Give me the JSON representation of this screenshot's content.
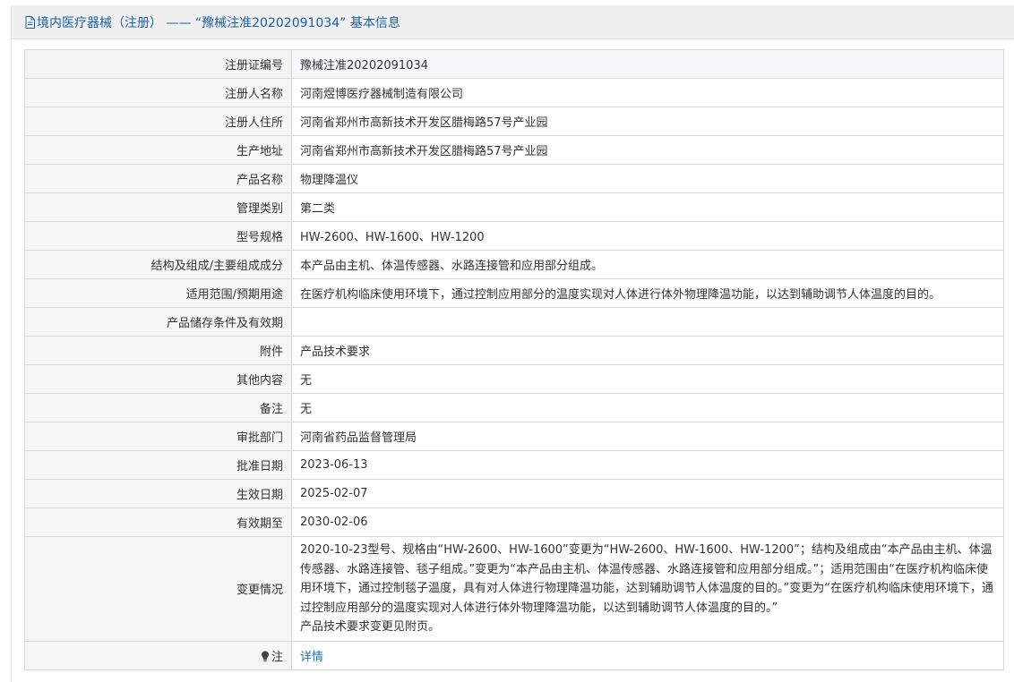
{
  "header": {
    "title": "境内医疗器械（注册） —— “豫械注准20202091034” 基本信息"
  },
  "rows": [
    {
      "label": "注册证编号",
      "value": "豫械注准20202091034"
    },
    {
      "label": "注册人名称",
      "value": "河南煜博医疗器械制造有限公司"
    },
    {
      "label": "注册人住所",
      "value": "河南省郑州市高新技术开发区腊梅路57号产业园"
    },
    {
      "label": "生产地址",
      "value": "河南省郑州市高新技术开发区腊梅路57号产业园"
    },
    {
      "label": "产品名称",
      "value": "物理降温仪"
    },
    {
      "label": "管理类别",
      "value": "第二类"
    },
    {
      "label": "型号规格",
      "value": "HW-2600、HW-1600、HW-1200"
    },
    {
      "label": "结构及组成/主要组成成分",
      "value": "本产品由主机、体温传感器、水路连接管和应用部分组成。"
    },
    {
      "label": "适用范围/预期用途",
      "value": "在医疗机构临床使用环境下，通过控制应用部分的温度实现对人体进行体外物理降温功能，以达到辅助调节人体温度的目的。"
    },
    {
      "label": "产品储存条件及有效期",
      "value": ""
    },
    {
      "label": "附件",
      "value": "产品技术要求"
    },
    {
      "label": "其他内容",
      "value": "无"
    },
    {
      "label": "备注",
      "value": "无"
    },
    {
      "label": "审批部门",
      "value": "河南省药品监督管理局"
    },
    {
      "label": "批准日期",
      "value": "2023-06-13"
    },
    {
      "label": "生效日期",
      "value": "2025-02-07"
    },
    {
      "label": "有效期至",
      "value": "2030-02-06"
    }
  ],
  "change": {
    "label": "变更情况",
    "text": "2020-10-23型号、规格由“HW-2600、HW-1600”变更为“HW-2600、HW-1600、HW-1200”；结构及组成由“本产品由主机、体温传感器、水路连接管、毯子组成。”变更为“本产品由主机、体温传感器、水路连接管和应用部分组成。”；适用范围由“在医疗机构临床使用环境下，通过控制毯子温度，具有对人体进行物理降温功能，达到辅助调节人体温度的目的。”变更为“在医疗机构临床使用环境下，通过控制应用部分的温度实现对人体进行体外物理降温功能，以达到辅助调节人体温度的目的。”",
    "note": "产品技术要求变更见附页。"
  },
  "footnote": {
    "label": "注",
    "link": "详情",
    "icon": "lightbulb-icon"
  }
}
